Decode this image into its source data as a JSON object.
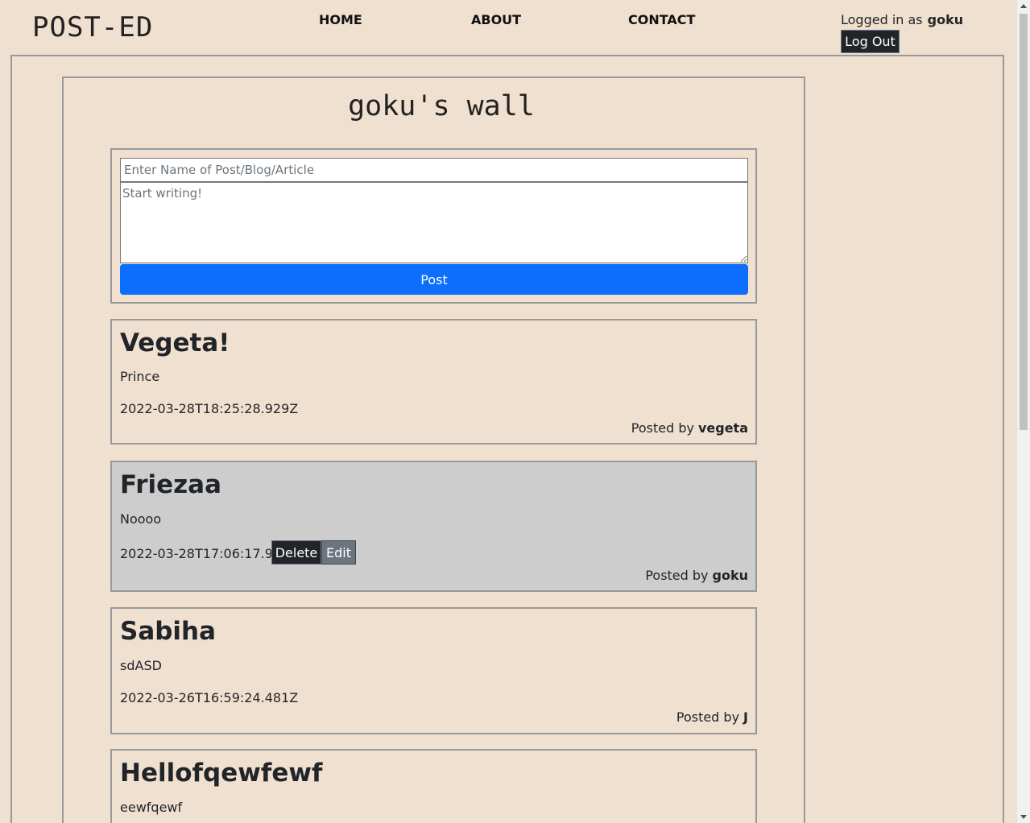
{
  "header": {
    "brand": "POST-ED",
    "nav": [
      "HOME",
      "ABOUT",
      "CONTACT"
    ],
    "logged_in_label": "Logged in as",
    "username": "goku",
    "logout_label": "Log Out"
  },
  "wall": {
    "title": "goku's wall"
  },
  "compose": {
    "title_placeholder": "Enter Name of Post/Blog/Article",
    "body_placeholder": "Start writing!",
    "post_label": "Post"
  },
  "posts": [
    {
      "title": "Vegeta!",
      "body": "Prince",
      "date": "2022-03-28T18:25:28.929Z",
      "posted_by_label": "Posted by",
      "author": "vegeta"
    },
    {
      "title": "Friezaa",
      "body": "Noooo",
      "date": "2022-03-28T17:06:17.936Z",
      "posted_by_label": "Posted by",
      "author": "goku",
      "delete_label": "Delete",
      "edit_label": "Edit"
    },
    {
      "title": "Sabiha",
      "body": "sdASD",
      "date": "2022-03-26T16:59:24.481Z",
      "posted_by_label": "Posted by",
      "author": "J"
    },
    {
      "title": "Hellofqewfewf",
      "body": "eewfqewf"
    }
  ],
  "colors": {
    "background": "#f0e0cf",
    "own_post_background": "#cdcdcd",
    "primary_button": "#0d6efd",
    "dark_button": "#212529",
    "secondary_button": "#6c757d"
  }
}
